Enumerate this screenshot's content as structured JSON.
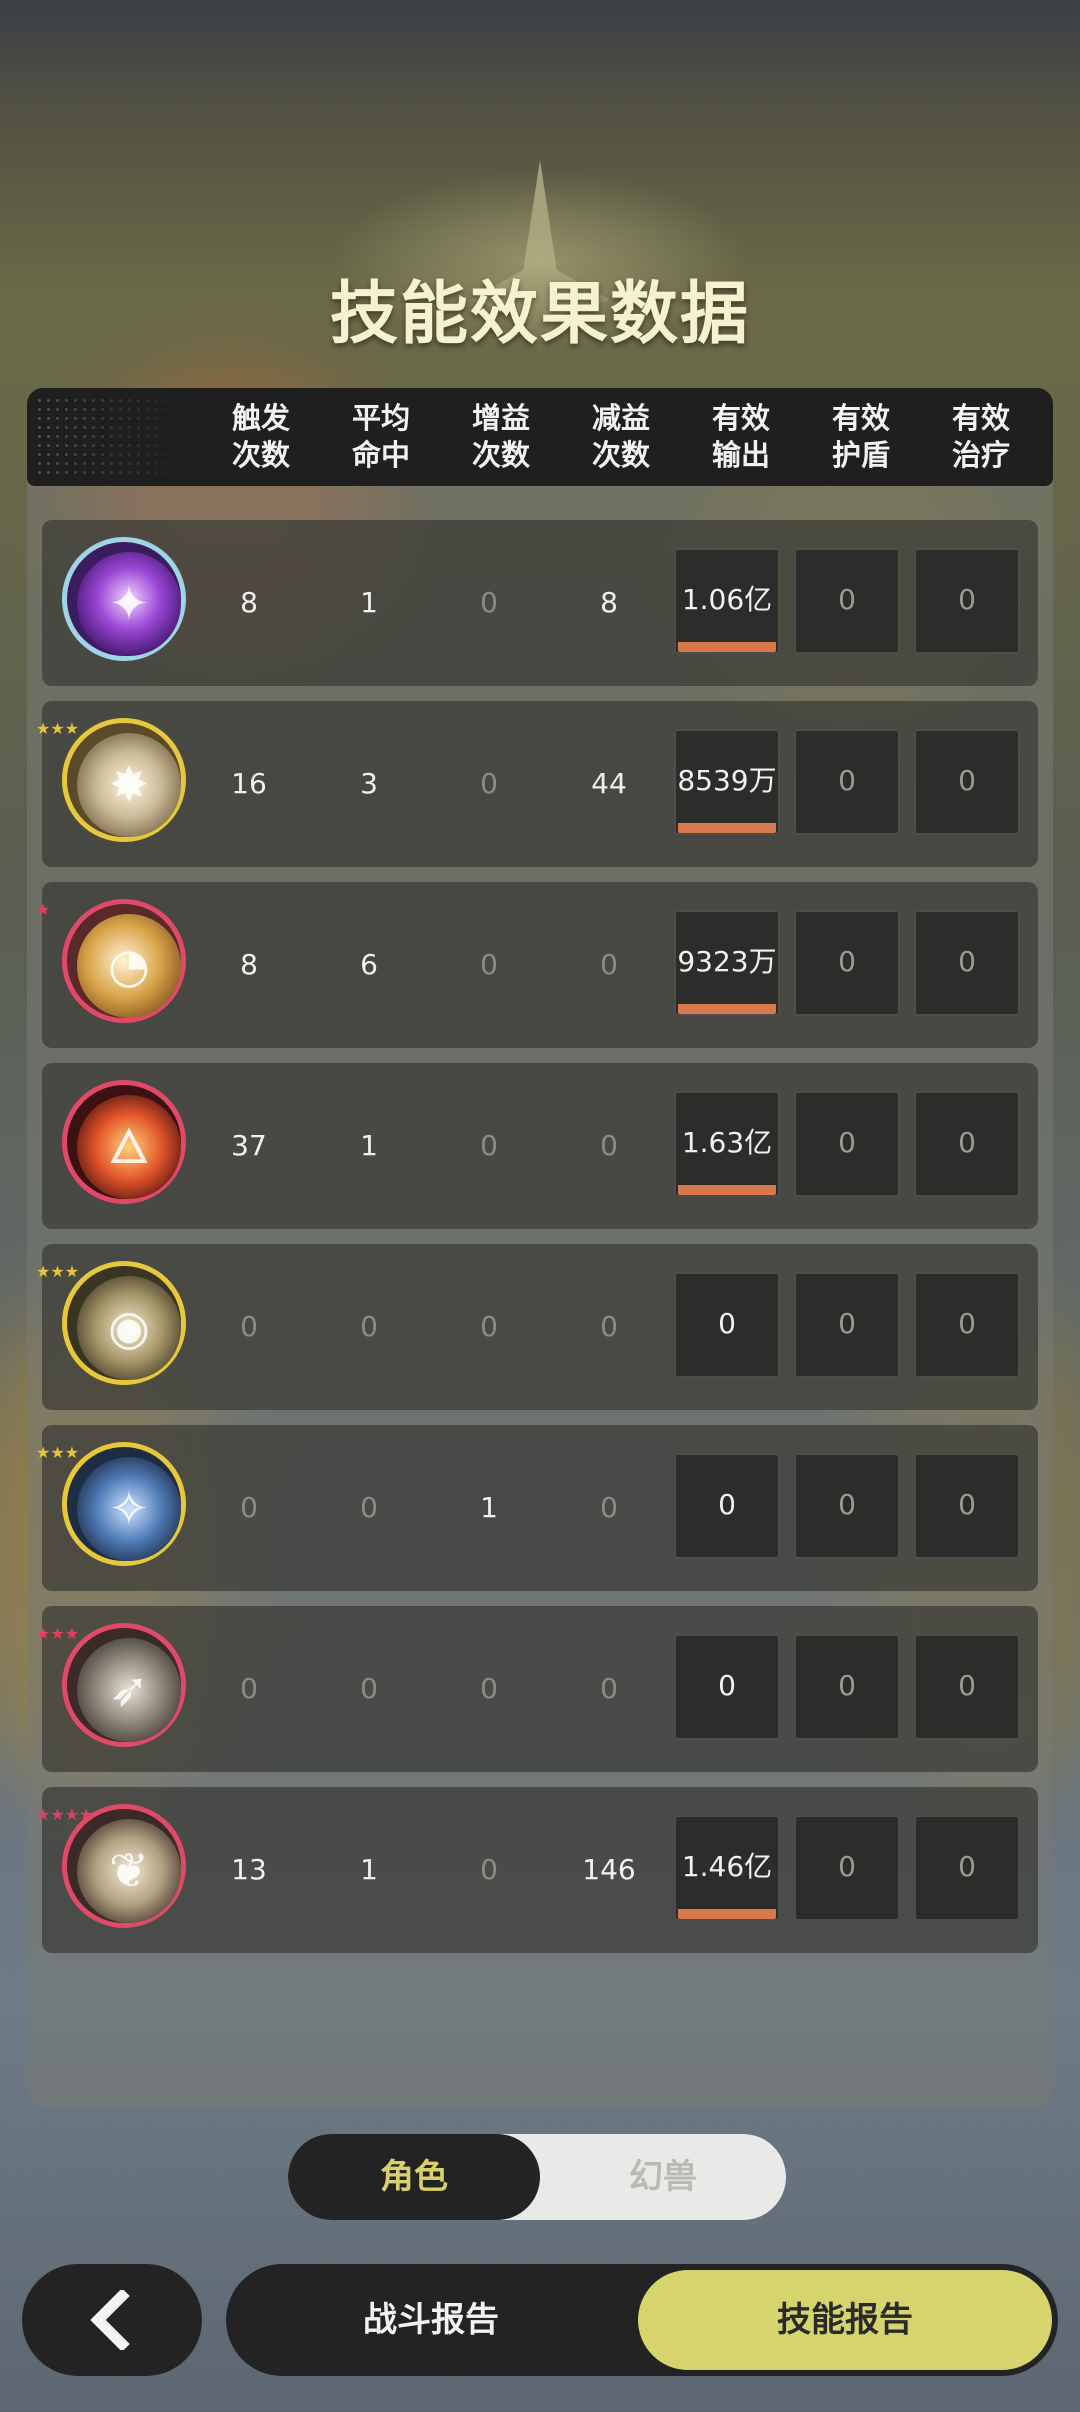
{
  "title": "技能效果数据",
  "columns": [
    {
      "line1": "触发",
      "line2": "次数"
    },
    {
      "line1": "平均",
      "line2": "命中"
    },
    {
      "line1": "增益",
      "line2": "次数"
    },
    {
      "line1": "减益",
      "line2": "次数"
    },
    {
      "line1": "有效",
      "line2": "输出"
    },
    {
      "line1": "有效",
      "line2": "护盾"
    },
    {
      "line1": "有效",
      "line2": "治疗"
    }
  ],
  "rows": [
    {
      "icon": "purple-heart-skill-icon",
      "stars": "",
      "trigger": "8",
      "avg_hit": "1",
      "buff": "0",
      "debuff": "8",
      "output": "1.06亿",
      "shield": "0",
      "heal": "0"
    },
    {
      "icon": "lightning-star-skill-icon",
      "stars": "★★★",
      "trigger": "16",
      "avg_hit": "3",
      "buff": "0",
      "debuff": "44",
      "output": "8539万",
      "shield": "0",
      "heal": "0"
    },
    {
      "icon": "golden-swirl-skill-icon",
      "stars": "★",
      "trigger": "8",
      "avg_hit": "6",
      "buff": "0",
      "debuff": "0",
      "output": "9323万",
      "shield": "0",
      "heal": "0"
    },
    {
      "icon": "fire-swirl-skill-icon",
      "stars": "",
      "trigger": "37",
      "avg_hit": "1",
      "buff": "0",
      "debuff": "0",
      "output": "1.63亿",
      "shield": "0",
      "heal": "0"
    },
    {
      "icon": "eye-skill-icon",
      "stars": "★★★",
      "trigger": "0",
      "avg_hit": "0",
      "buff": "0",
      "debuff": "0",
      "output": "0",
      "shield": "0",
      "heal": "0"
    },
    {
      "icon": "blue-crest-skill-icon",
      "stars": "★★★",
      "trigger": "0",
      "avg_hit": "0",
      "buff": "1",
      "debuff": "0",
      "output": "0",
      "shield": "0",
      "heal": "0"
    },
    {
      "icon": "archer-skill-icon",
      "stars": "★★★",
      "trigger": "0",
      "avg_hit": "0",
      "buff": "0",
      "debuff": "0",
      "output": "0",
      "shield": "0",
      "heal": "0"
    },
    {
      "icon": "leaf-skill-icon",
      "stars": "★★★★",
      "trigger": "13",
      "avg_hit": "1",
      "buff": "0",
      "debuff": "146",
      "output": "1.46亿",
      "shield": "0",
      "heal": "0"
    }
  ],
  "toggle": {
    "left": "角色",
    "right": "幻兽",
    "active": "角色"
  },
  "bottom": {
    "back_icon": "chevron-left-icon",
    "report": "战斗报告",
    "skill_report": "技能报告",
    "active": "技能报告"
  },
  "colors": {
    "accent": "#d6d46c",
    "output_bar": "#d9784c",
    "panel_dark": "#232323"
  }
}
